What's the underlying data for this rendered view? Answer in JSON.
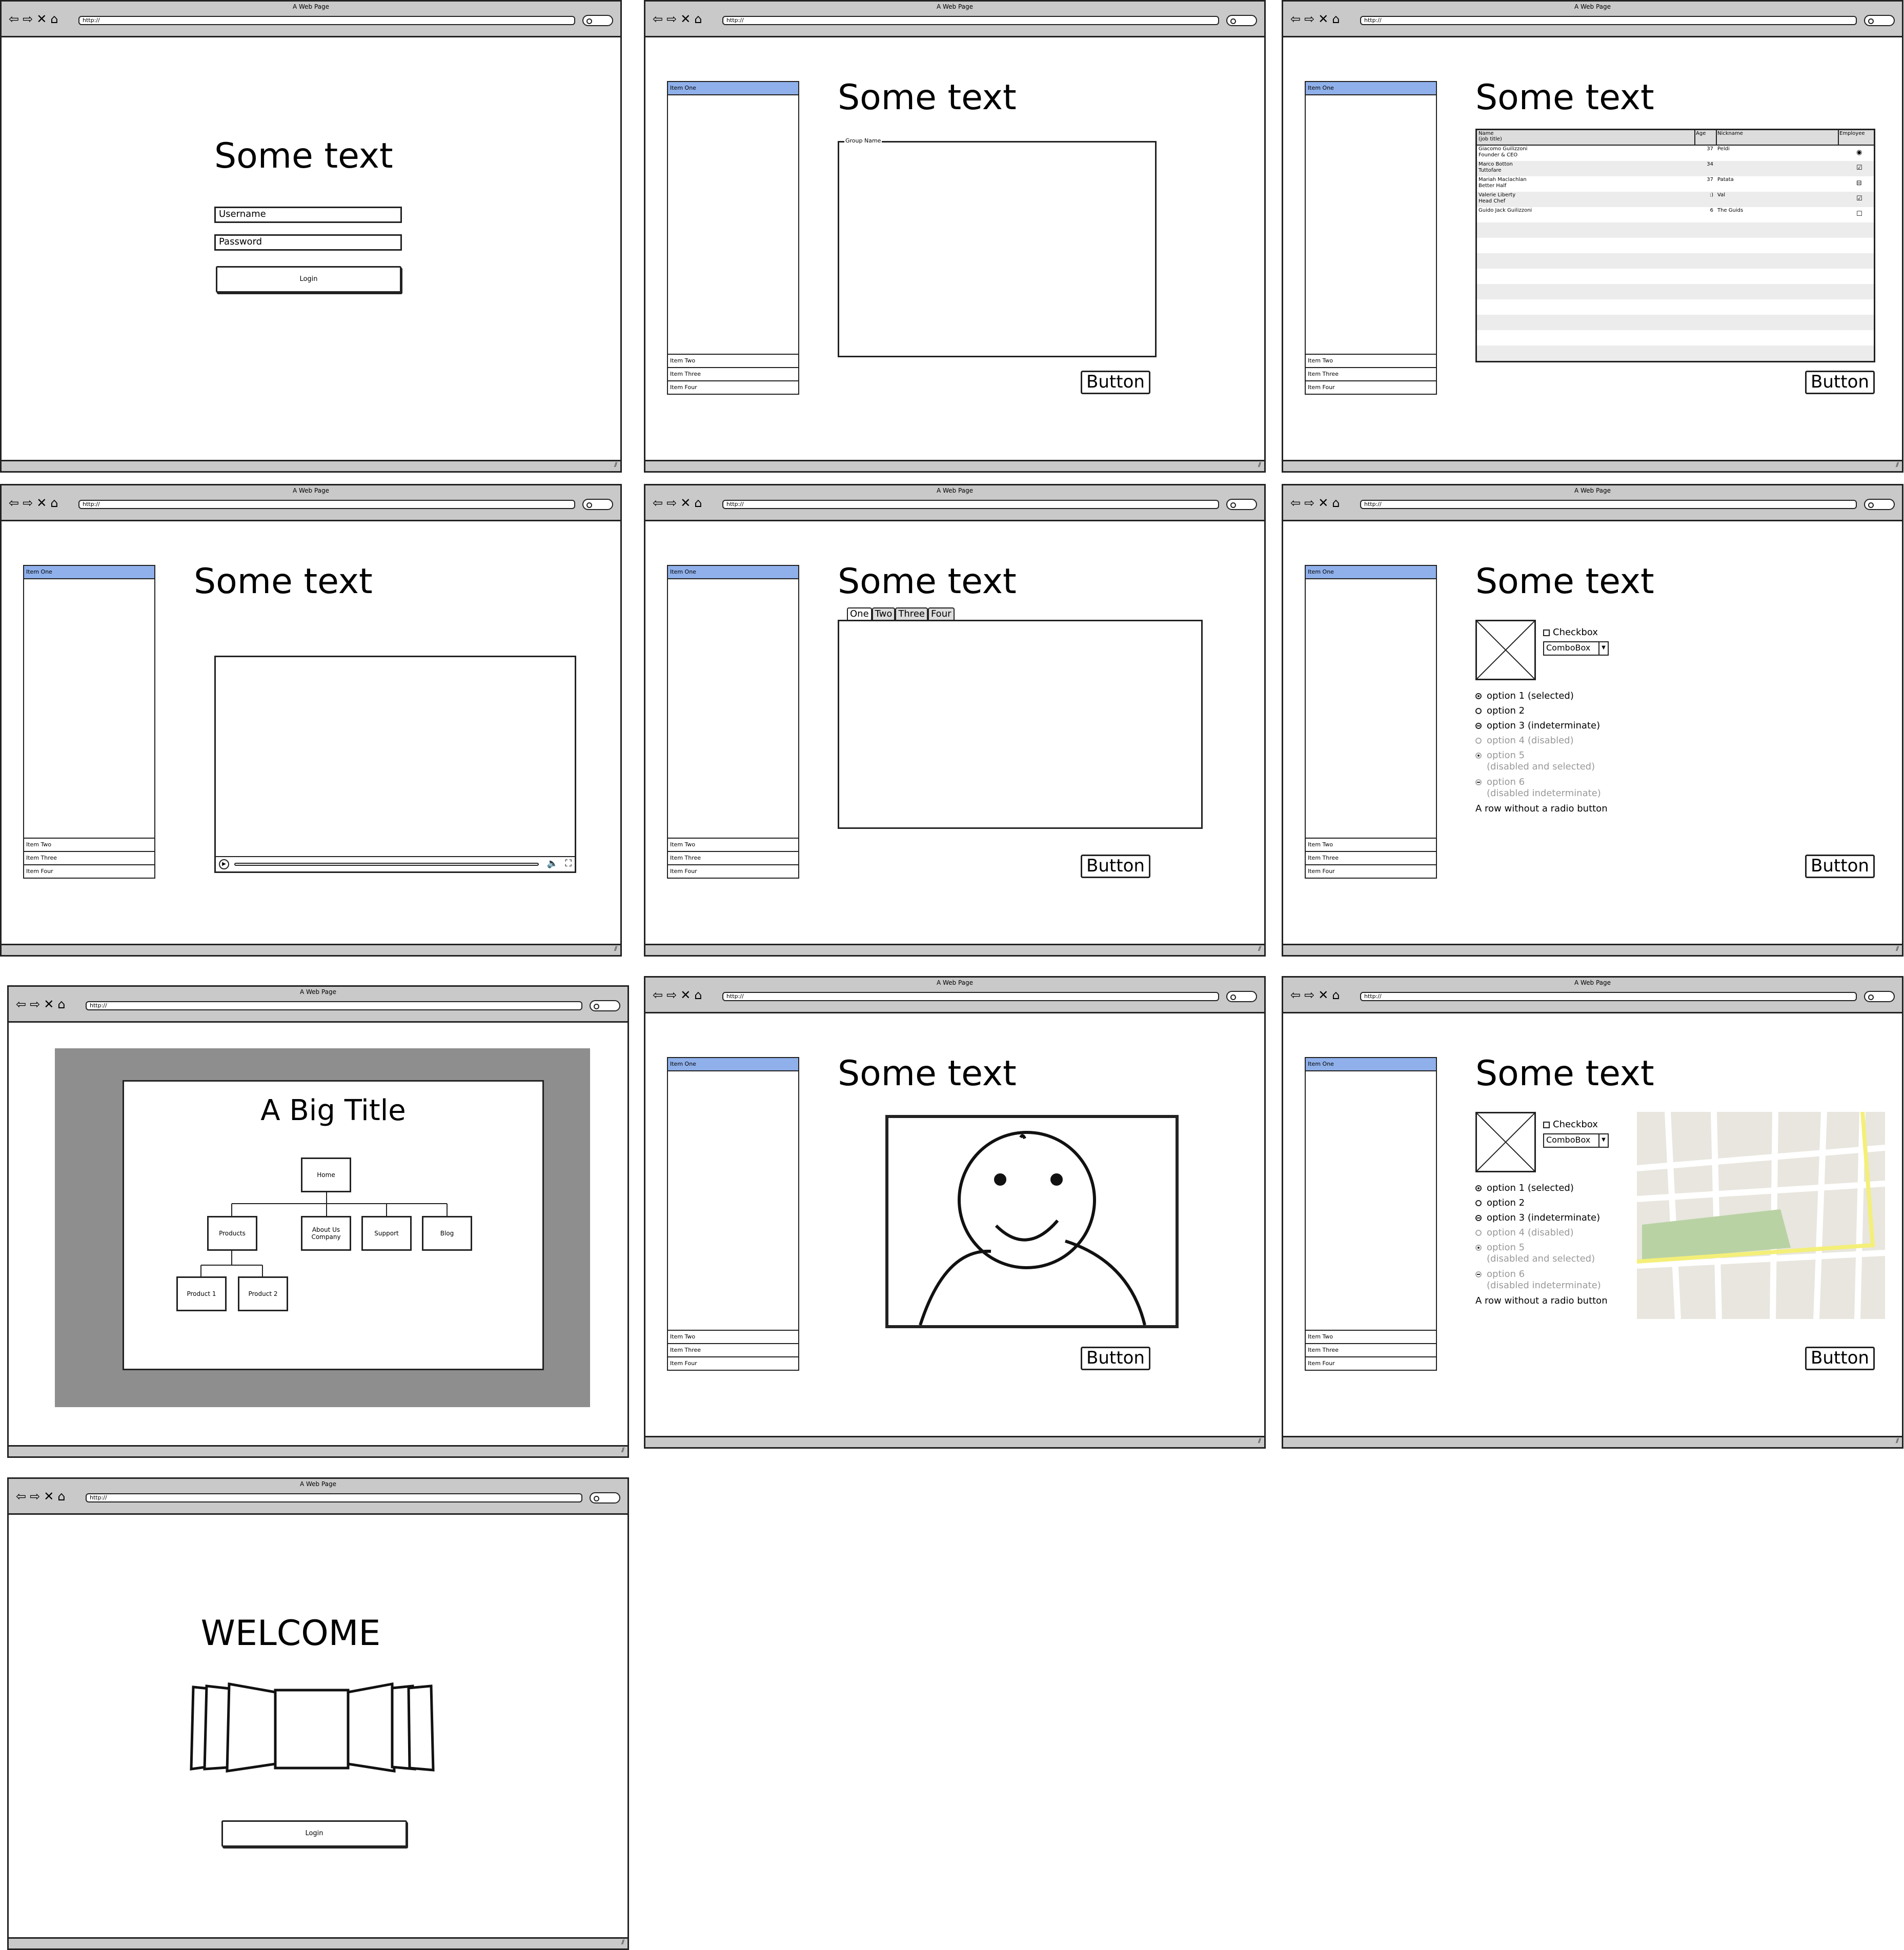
{
  "browser": {
    "title": "A Web Page",
    "url": "http://",
    "nav_icons": [
      "back-arrow-icon",
      "forward-arrow-icon",
      "close-x-icon",
      "home-icon"
    ],
    "resize_glyph": "⫽"
  },
  "panels": {
    "login": {
      "heading": "Some text",
      "username_placeholder": "Username",
      "password_placeholder": "Password",
      "login_label": "Login"
    },
    "groupbox": {
      "heading": "Some text",
      "group_name": "Group Name",
      "button_label": "Button"
    },
    "datagrid": {
      "heading": "Some text",
      "columns": [
        "Name\n(job title)",
        "Age",
        "Nickname",
        "Employee"
      ],
      "rows": [
        {
          "name": "Giacomo Guilizzoni",
          "title": "Founder & CEO",
          "age": "37",
          "nickname": "Peldi",
          "employee": "radio"
        },
        {
          "name": "Marco Botton",
          "title": "Tuttofare",
          "age": "34",
          "nickname": "",
          "employee": "checked"
        },
        {
          "name": "Mariah Maclachlan",
          "title": "Better Half",
          "age": "37",
          "nickname": "Patata",
          "employee": "indeterminate"
        },
        {
          "name": "Valerie Liberty",
          "title": "Head Chef",
          "age": ":)",
          "nickname": "Val",
          "employee": "checked"
        },
        {
          "name": "Guido Jack Guilizzoni",
          "title": "",
          "age": "6",
          "nickname": "The Guids",
          "employee": "unchecked"
        }
      ],
      "button_label": "Button"
    },
    "video": {
      "heading": "Some text",
      "controls": [
        "play-icon",
        "volume-icon",
        "fullscreen-icon"
      ]
    },
    "tabs": {
      "heading": "Some text",
      "tab_labels": [
        "One",
        "Two",
        "Three",
        "Four"
      ],
      "button_label": "Button"
    },
    "form": {
      "heading": "Some text",
      "checkbox_label": "Checkbox",
      "combo_label": "ComboBox",
      "radios": [
        {
          "text": "option 1 (selected)",
          "state": "on",
          "disabled": false
        },
        {
          "text": "option 2",
          "state": "off",
          "disabled": false
        },
        {
          "text": "option 3 (indeterminate)",
          "state": "ind",
          "disabled": false
        },
        {
          "text": "option 4 (disabled)",
          "state": "off",
          "disabled": true
        },
        {
          "text": "option 5\n(disabled and selected)",
          "state": "on",
          "disabled": true
        },
        {
          "text": "option 6\n(disabled indeterminate)",
          "state": "ind",
          "disabled": true
        }
      ],
      "plain_row": "A row without a radio button",
      "button_label": "Button"
    },
    "sitemap": {
      "title": "A Big Title",
      "nodes": {
        "home": "Home",
        "products": "Products",
        "about": "About Us\nCompany",
        "support": "Support",
        "blog": "Blog",
        "product1": "Product 1",
        "product2": "Product 2"
      }
    },
    "image": {
      "heading": "Some text",
      "button_label": "Button"
    },
    "formmap": {
      "heading": "Some text",
      "checkbox_label": "Checkbox",
      "combo_label": "ComboBox",
      "button_label": "Button"
    },
    "welcome": {
      "heading": "WELCOME",
      "login_label": "Login"
    }
  },
  "list": {
    "items": [
      "Item One",
      "Item Two",
      "Item Three",
      "Item Four"
    ],
    "selected_color": "#8fb0ea"
  },
  "colors": {
    "chrome": "#c9c9c9",
    "map_park": "#b9d2a4",
    "map_road": "#f4ef78",
    "map_bg": "#e8e6de",
    "sitemap_bg": "#8e8e8e"
  }
}
